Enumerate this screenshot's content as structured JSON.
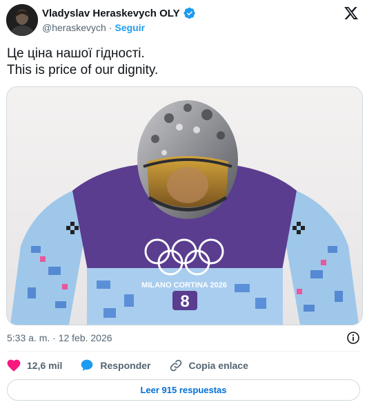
{
  "author": {
    "display_name": "Vladyslav Heraskevych OLY",
    "handle": "@heraskevych",
    "separator": "·",
    "follow_label": "Seguir"
  },
  "tweet": {
    "line_1": "Це ціна нашої гідності.",
    "line_2": "This is price of our dignity."
  },
  "media": {
    "bib_number": "8",
    "games_text": "MILANO CORTINA 2026"
  },
  "meta": {
    "timestamp": "5:33 a. m. · 12 feb. 2026"
  },
  "actions": {
    "like_count": "12,6 mil",
    "reply_label": "Responder",
    "copy_link_label": "Copia enlace"
  },
  "read_replies_label": "Leer 915 respuestas",
  "colors": {
    "accent": "#1d9bf0",
    "link": "#006fd6",
    "like": "#f91880",
    "muted": "#536471",
    "suit": "#5a3d8f"
  },
  "icons": {
    "verified": "verified-badge-icon",
    "logo": "x-logo-icon",
    "info": "info-icon",
    "like": "heart-icon",
    "reply": "speech-bubble-icon",
    "copy": "link-icon"
  }
}
